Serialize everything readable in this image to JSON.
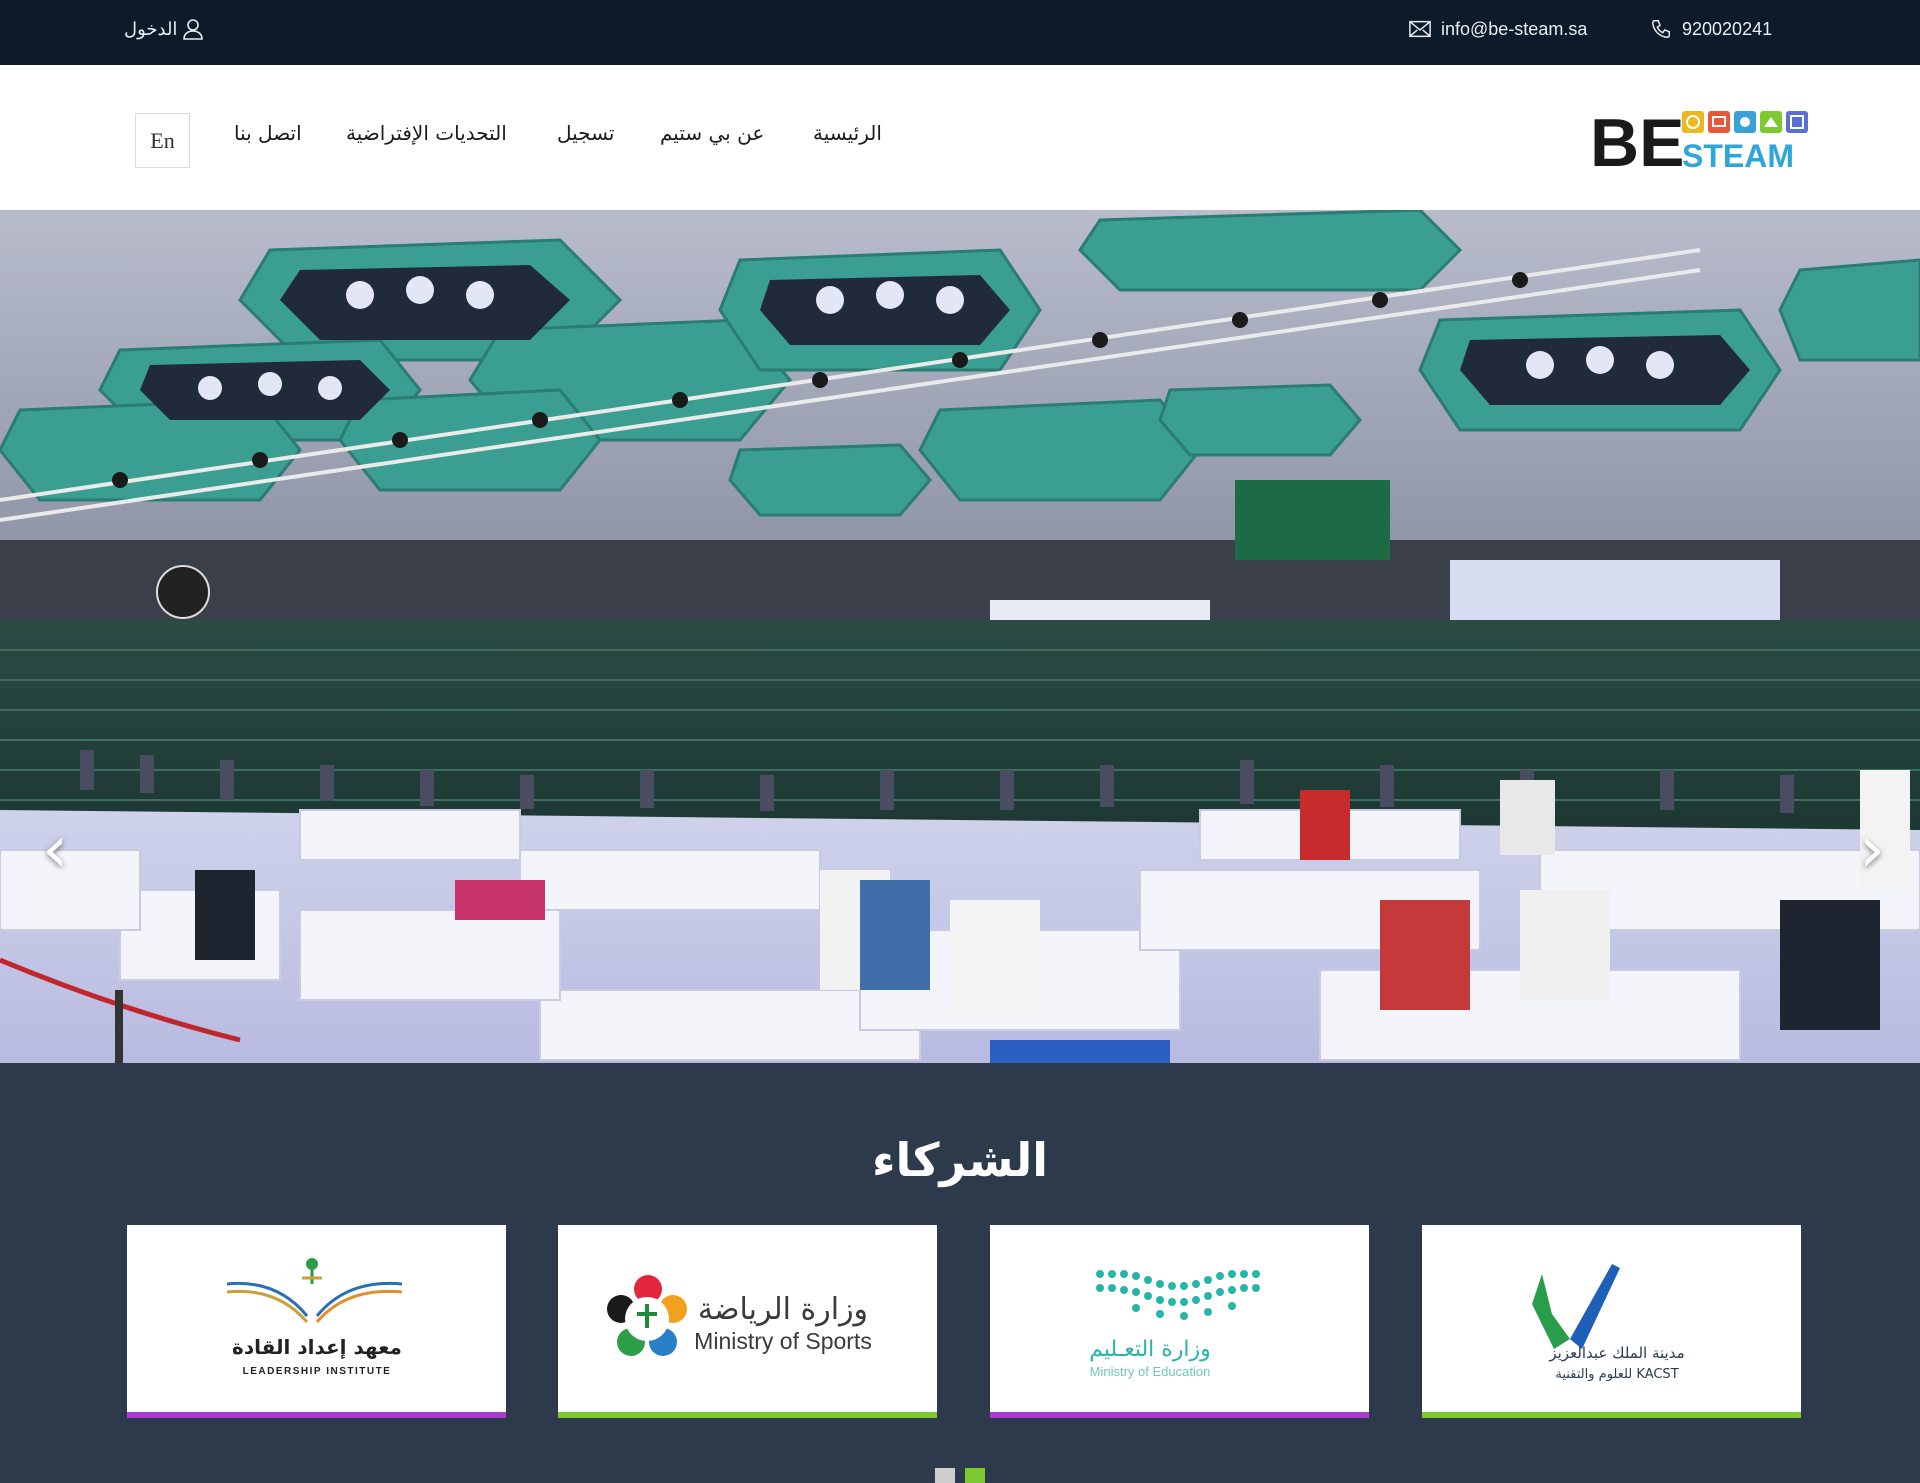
{
  "topbar": {
    "phone": "920020241",
    "email": "info@be-steam.sa",
    "login": "الدخول"
  },
  "nav": {
    "logo_big": "BE",
    "logo_small": "STEAM",
    "items": [
      "الرئيسية",
      "عن بي ستيم",
      "تسجيل",
      "التحديات الإفتراضية",
      "اتصل بنا"
    ],
    "lang": "En"
  },
  "hero": {
    "prev": "‹",
    "next": "›"
  },
  "partners": {
    "title": "الشركاء",
    "cards": [
      {
        "ar": "مدينة الملك عبدالعزيز",
        "ar2": "للعلوم والتقنية KACST",
        "bar": "#7ec832"
      },
      {
        "ar": "وزارة التعـليم",
        "en": "Ministry of Education",
        "bar": "#a63fd1"
      },
      {
        "ar": "وزارة الرياضة",
        "en": "Ministry of Sports",
        "bar": "#7ec832"
      },
      {
        "ar": "معهد إعداد القادة",
        "en": "LEADERSHIP INSTITUTE",
        "bar": "#a63fd1"
      }
    ],
    "dots": [
      "#cfcfcf",
      "#7ec832"
    ]
  },
  "colors": {
    "topbar_bg": "#0c1a2a",
    "partners_bg": "#2c3a4c",
    "accent_green": "#7ec832",
    "accent_purple": "#a63fd1"
  }
}
